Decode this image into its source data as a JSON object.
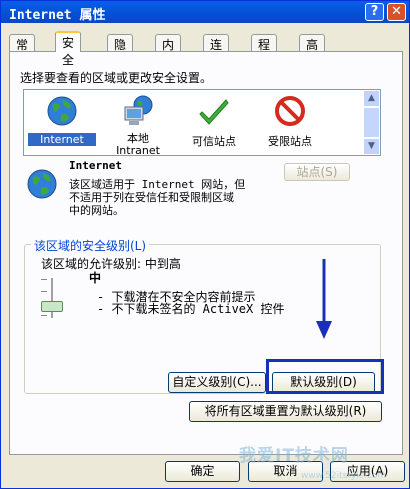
{
  "window": {
    "title": "Internet 属性",
    "help_glyph": "?",
    "close_glyph": "✕"
  },
  "tabs": [
    {
      "label": "常规"
    },
    {
      "label": "安全"
    },
    {
      "label": "隐私"
    },
    {
      "label": "内容"
    },
    {
      "label": "连接"
    },
    {
      "label": "程序"
    },
    {
      "label": "高级"
    }
  ],
  "active_tab": "安全",
  "instruction": "选择要查看的区域或更改安全设置。",
  "zones": [
    {
      "label": "Internet",
      "icon": "globe-icon",
      "selected": true
    },
    {
      "label": "本地\nIntranet",
      "line1": "本地",
      "line2": "Intranet",
      "icon": "intranet-computer-icon"
    },
    {
      "label": "可信站点",
      "icon": "green-check-icon"
    },
    {
      "label": "受限站点",
      "icon": "prohibited-icon"
    }
  ],
  "zone_info": {
    "title": "Internet",
    "description_lines": [
      "该区域适用于 Internet 网站，但",
      "不适用于列在受信任和受限制区域",
      "中的网站。"
    ],
    "sites_button": "站点(S)"
  },
  "security_level": {
    "group_label": "该区域的安全级别(L)",
    "allowed_text": "该区域的允许级别: 中到高",
    "level_name": "中",
    "bullets": [
      "- 下载潜在不安全内容前提示",
      "- 不下载未签名的 ActiveX 控件"
    ],
    "custom_button": "自定义级别(C)...",
    "default_button": "默认级别(D)",
    "reset_all_button": "将所有区域重置为默认级别(R)"
  },
  "footer": {
    "ok": "确定",
    "cancel": "取消",
    "apply": "应用(A)"
  },
  "watermark": {
    "main": "我爱IT技术网",
    "sub": "www.52itstyle.com"
  },
  "colors": {
    "title_bar": "#0450d4",
    "active_tab_accent": "#ffc83c",
    "highlight_border": "#1a2fb8",
    "selection": "#316ac5"
  }
}
